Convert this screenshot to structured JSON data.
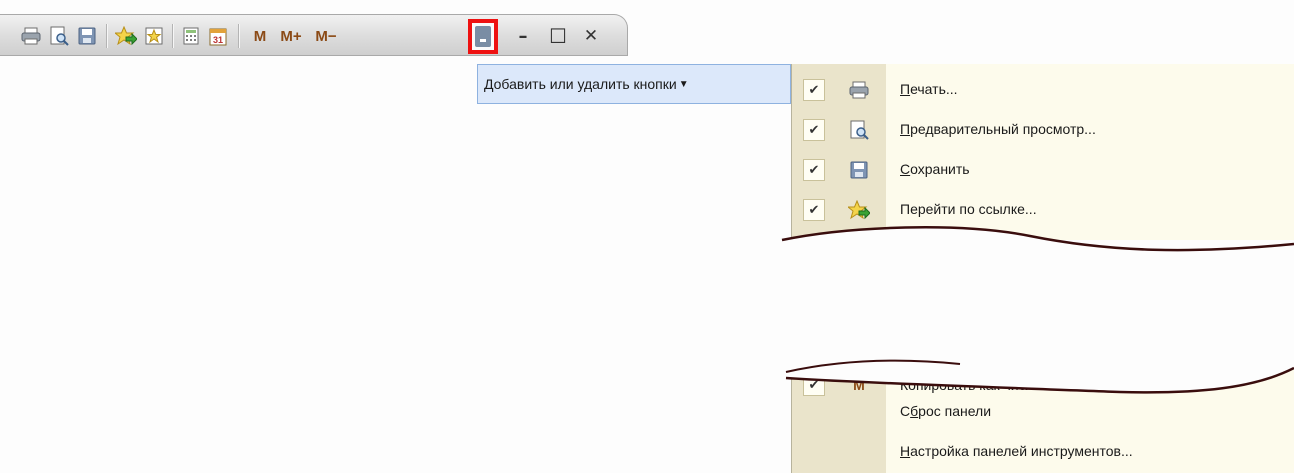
{
  "toolbar": {
    "buttons": [
      {
        "name": "print-icon"
      },
      {
        "name": "print-preview-icon"
      },
      {
        "name": "save-icon"
      },
      {
        "name": "go-to-link-icon"
      },
      {
        "name": "favorites-icon"
      },
      {
        "name": "calculator-icon"
      },
      {
        "name": "calendar-icon"
      }
    ],
    "m_label": "M",
    "m_plus_label": "M+",
    "m_minus_label": "M−",
    "minimize_glyph": "–",
    "maximize_glyph": "☐",
    "close_glyph": "✕"
  },
  "tooltip": {
    "label": "Добавить или удалить кнопки",
    "arrow": "▼"
  },
  "menu": {
    "items": [
      {
        "label_hotkey": "П",
        "label_rest": "ечать...",
        "checked": true,
        "icon": "print-icon"
      },
      {
        "label_hotkey": "П",
        "label_rest": "редварительный просмотр...",
        "checked": true,
        "icon": "print-preview-icon"
      },
      {
        "label_hotkey": "С",
        "label_rest": "охранить",
        "checked": true,
        "icon": "save-icon"
      },
      {
        "label_hotkey": "",
        "label_rest": "Перейти по ссылке...",
        "checked": true,
        "icon": "go-to-link-icon"
      }
    ],
    "partial_item": {
      "label": "Копировать как число",
      "icon_text": "M",
      "checked": true
    },
    "reset": {
      "pre": "С",
      "hotkey": "б",
      "post": "рос панели"
    },
    "settings": {
      "hotkey": "Н",
      "post": "астройка панелей инструментов..."
    },
    "check_glyph": "✔"
  },
  "colors": {
    "highlight_border": "#ee1111",
    "tooltip_bg": "#dce8fa",
    "menu_bg": "#fdfbec",
    "gutter_bg": "#eae4cb"
  }
}
